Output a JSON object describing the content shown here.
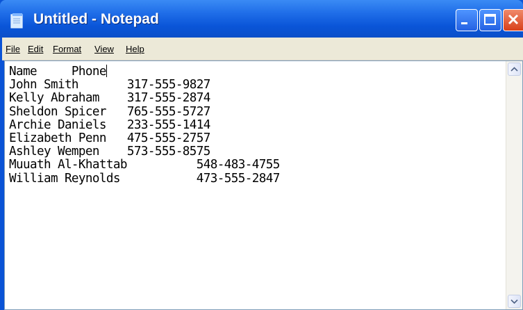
{
  "window": {
    "title": "Untitled - Notepad",
    "icon": "notepad-icon"
  },
  "title_buttons": {
    "minimize_icon": "minimize-icon",
    "maximize_icon": "maximize-icon",
    "close_icon": "close-icon"
  },
  "menu": {
    "items": [
      {
        "label": "File"
      },
      {
        "label": "Edit"
      },
      {
        "label": "Format"
      },
      {
        "label": "View"
      },
      {
        "label": "Help"
      }
    ]
  },
  "editor": {
    "lines": [
      "Name     Phone",
      "John Smith       317-555-9827",
      "Kelly Abraham    317-555-2874",
      "Sheldon Spicer   765-555-5727",
      "Archie Daniels   233-555-1414",
      "Elizabeth Penn   475-555-2757",
      "Ashley Wempen    573-555-8575",
      "Muuath Al-Khattab          548-483-4755",
      "William Reynolds           473-555-2847"
    ]
  },
  "scrollbar": {
    "up_icon": "scroll-up-arrow-icon",
    "down_icon": "scroll-down-arrow-icon"
  },
  "colors": {
    "titlebar": "#0a55d8",
    "menubar": "#ece9d8",
    "close_button": "#d8401a"
  }
}
